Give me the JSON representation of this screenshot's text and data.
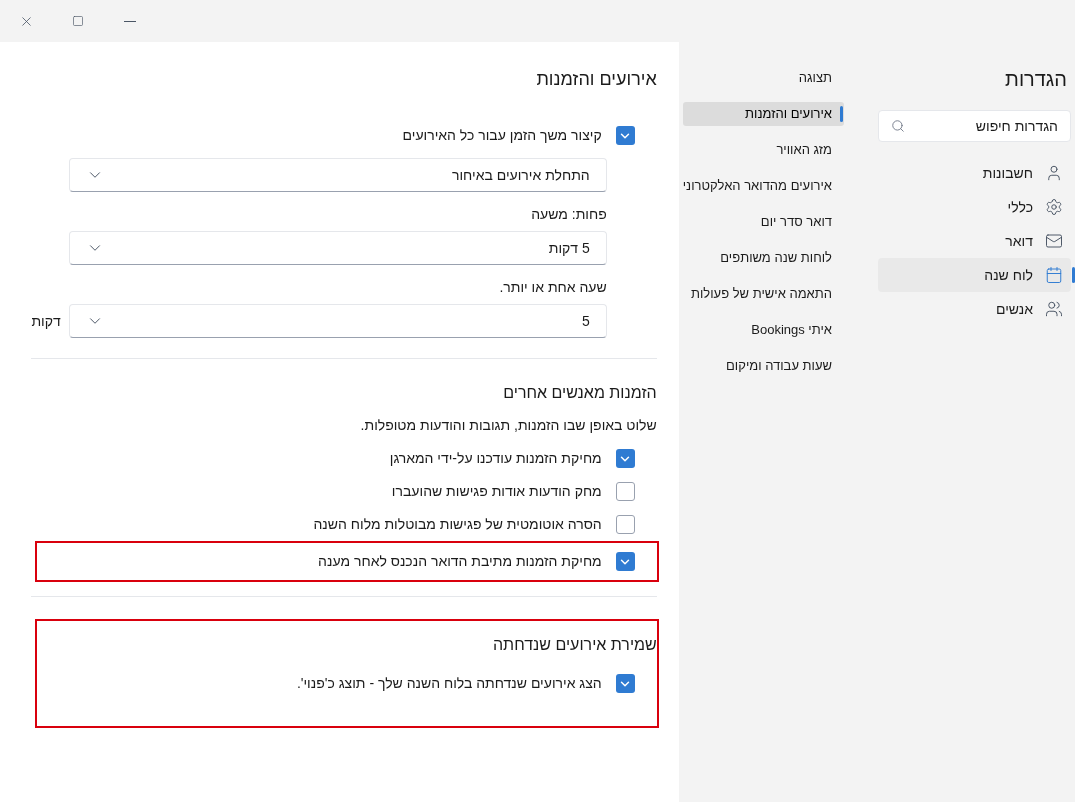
{
  "sidebar": {
    "title": "הגדרות",
    "search": {
      "placeholder": "הגדרות חיפוש"
    },
    "items": [
      {
        "label": "חשבונות",
        "selected": false
      },
      {
        "label": "כללי",
        "selected": false
      },
      {
        "label": "דואר",
        "selected": false
      },
      {
        "label": "לוח שנה",
        "selected": true
      },
      {
        "label": "אנשים",
        "selected": false
      }
    ]
  },
  "subnav": {
    "items": [
      {
        "label": "תצוגה",
        "selected": false
      },
      {
        "label": "אירועים והזמנות",
        "selected": true
      },
      {
        "label": "מזג האוויר",
        "selected": false
      },
      {
        "label": "אירועים מהדואר האלקטרוני",
        "selected": false
      },
      {
        "label": "דואר סדר יום",
        "selected": false
      },
      {
        "label": "לוחות שנה משותפים",
        "selected": false
      },
      {
        "label": "התאמה אישית של פעולות",
        "selected": false
      },
      {
        "label": "איתי Bookings",
        "selected": false
      },
      {
        "label": "שעות עבודה ומיקום",
        "selected": false
      }
    ]
  },
  "content": {
    "title": "אירועים והזמנות",
    "sections": [
      {
        "items": [
          {
            "kind": "checkbox",
            "label": "קיצור משך הזמן עבור כל האירועים",
            "checked": true,
            "highlighted": false
          },
          {
            "kind": "dropdown",
            "value": "התחלת אירועים באיחור"
          },
          {
            "kind": "label",
            "label": "פחות: משעה"
          },
          {
            "kind": "dropdown",
            "value": "5 דקות"
          },
          {
            "kind": "label",
            "label": "שעה אחת או יותר."
          },
          {
            "kind": "dropdown",
            "value": "5",
            "suffix": "דקות"
          }
        ]
      },
      {
        "title": "הזמנות מאנשים אחרים",
        "description": "שלוט באופן שבו הזמנות, תגובות והודעות מטופלות.",
        "highlighted": false,
        "items": [
          {
            "kind": "checkbox",
            "label": "מחיקת הזמנות עודכנו על-ידי המארגן",
            "checked": true,
            "highlighted": false
          },
          {
            "kind": "checkbox",
            "label": "מחק הודעות אודות פגישות שהועברו",
            "checked": false,
            "highlighted": false
          },
          {
            "kind": "checkbox",
            "label": "הסרה אוטומטית של פגישות מבוטלות מלוח השנה",
            "checked": false,
            "highlighted": false
          },
          {
            "kind": "checkbox",
            "label": "מחיקת הזמנות מתיבת הדואר הנכנס לאחר מענה",
            "checked": true,
            "highlighted": true
          }
        ]
      },
      {
        "title": "שמירת אירועים שנדחתה",
        "highlighted": true,
        "items": [
          {
            "kind": "checkbox",
            "label": "הצג אירועים שנדחתה בלוח השנה שלך - תוצג כ'פנוי'.",
            "checked": true,
            "highlighted": false
          }
        ]
      }
    ]
  }
}
